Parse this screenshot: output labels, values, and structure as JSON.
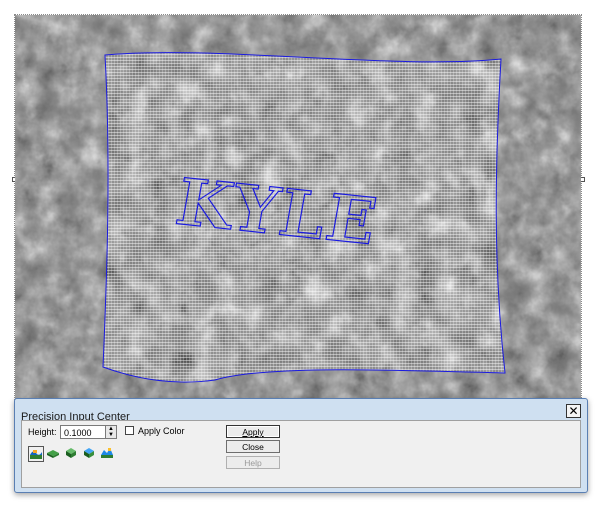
{
  "canvas": {
    "overlay_text": "KYLE",
    "outline_color": "#1a1ae0"
  },
  "dialog": {
    "title": "Precision Input Center",
    "close_glyph": "✕",
    "height_label": "Height:",
    "height_value": "0.1000",
    "apply_color_label": "Apply Color",
    "apply_color_checked": false,
    "buttons": {
      "apply": "Apply",
      "close": "Close",
      "help": "Help"
    },
    "tool_icons": [
      {
        "name": "wave-tool-icon",
        "selected": true
      },
      {
        "name": "flat-slab-tool-icon",
        "selected": false
      },
      {
        "name": "box-raise-tool-icon",
        "selected": false
      },
      {
        "name": "stack-tool-icon",
        "selected": false
      },
      {
        "name": "relief-tool-icon",
        "selected": false
      }
    ]
  }
}
